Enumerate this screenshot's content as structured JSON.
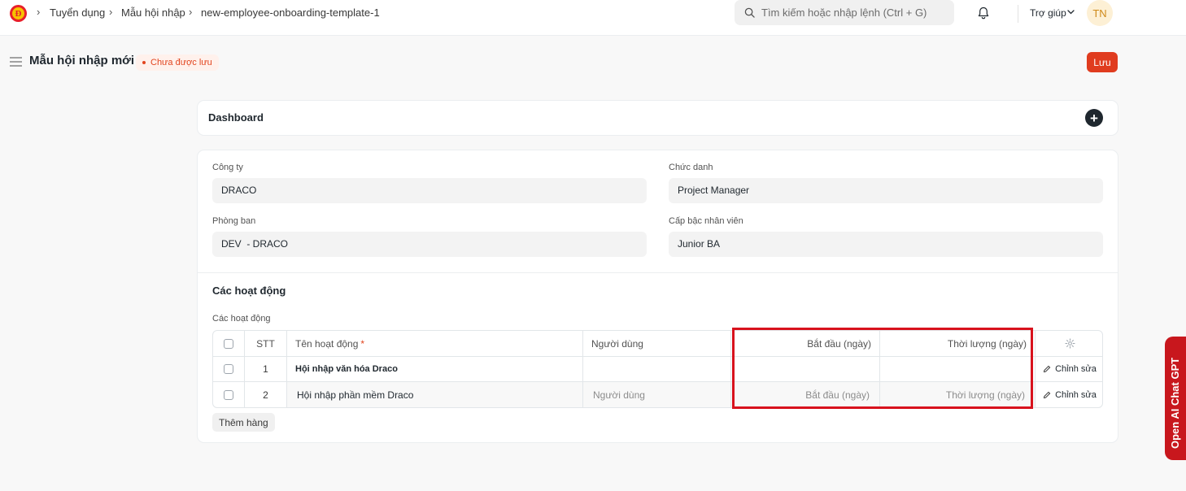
{
  "app": {
    "logo_letter": "Đ",
    "logo_color": "#e8202a"
  },
  "breadcrumb": {
    "items": [
      "Tuyển dụng",
      "Mẫu hội nhập",
      "new-employee-onboarding-template-1"
    ]
  },
  "search": {
    "placeholder": "Tìm kiếm hoặc nhập lệnh (Ctrl + G)"
  },
  "navbar": {
    "help_label": "Trợ giúp",
    "avatar_initials": "TN"
  },
  "page": {
    "title": "Mẫu hội nhập mới",
    "status": "Chưa được lưu",
    "save_label": "Lưu"
  },
  "dashboard": {
    "title": "Dashboard"
  },
  "form": {
    "company": {
      "label": "Công ty",
      "value": "DRACO"
    },
    "designation": {
      "label": "Chức danh",
      "value": "Project Manager"
    },
    "department": {
      "label": "Phòng ban",
      "value": "DEV  - DRACO"
    },
    "grade": {
      "label": "Cấp bậc nhân viên",
      "value": "Junior BA"
    }
  },
  "activities": {
    "section_title": "Các hoạt động",
    "table_label": "Các hoạt động",
    "columns": {
      "no": "STT",
      "activity_name": "Tên hoạt động",
      "user": "Người dùng",
      "begin_on": "Bắt đầu (ngày)",
      "duration": "Thời lượng (ngày)"
    },
    "rows": [
      {
        "no": "1",
        "activity_name": "Hội nhập văn hóa Draco",
        "user": "",
        "begin_on": "",
        "duration": "",
        "edit": "Chỉnh sửa"
      },
      {
        "no": "2",
        "activity_name": "Hội nhập phần mềm Draco",
        "user": "Người dùng",
        "begin_on": "Bắt đầu (ngày)",
        "duration": "Thời lượng (ngày)",
        "edit": "Chỉnh sửa"
      }
    ],
    "add_row_label": "Thêm hàng"
  },
  "side_tab": {
    "label": "Open AI Chat GPT"
  },
  "colors": {
    "accent": "#e03c1f",
    "highlight": "#d8121d"
  }
}
